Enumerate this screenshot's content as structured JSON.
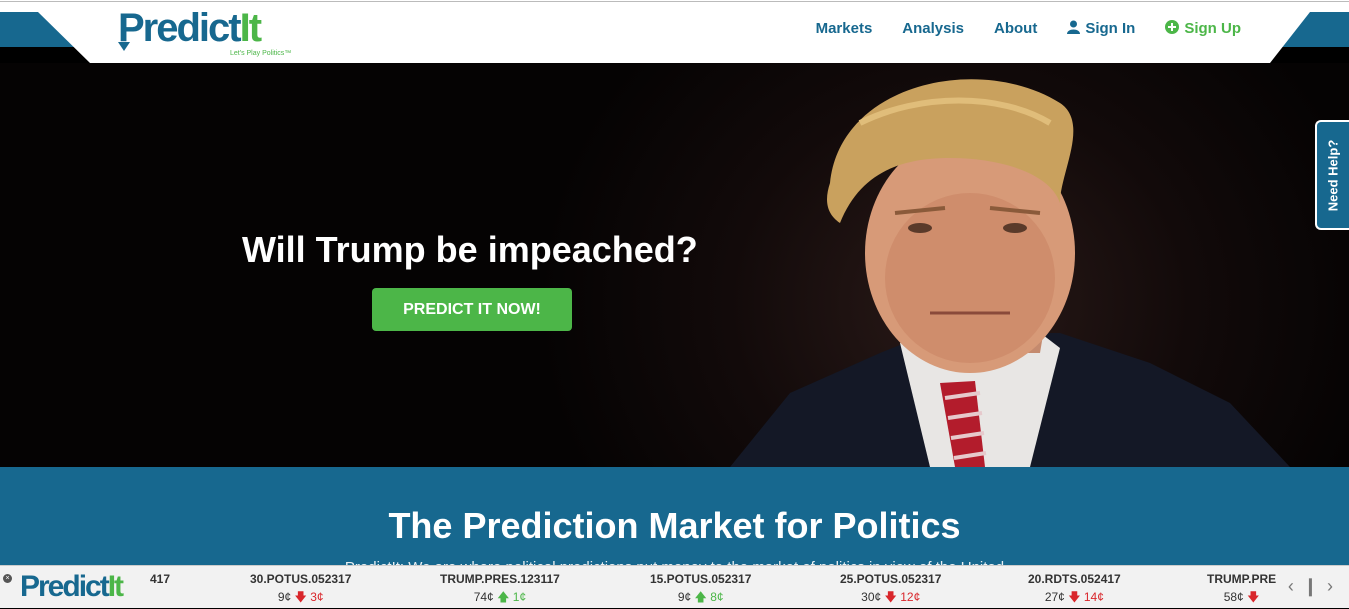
{
  "header": {
    "logo_left": "Predict",
    "logo_right": "It",
    "logo_tagline": "Let's Play Politics™",
    "nav": {
      "markets": "Markets",
      "analysis": "Analysis",
      "about": "About",
      "signin": "Sign In",
      "signup": "Sign Up"
    }
  },
  "hero": {
    "title": "Will Trump be impeached?",
    "button": "PREDICT IT NOW!"
  },
  "help_tab": "Need Help?",
  "section": {
    "title": "The Prediction Market for Politics",
    "subtitle": "PredictIt: We are where political predictions put money to the market of politics in view of the United"
  },
  "ticker": {
    "logo_left": "Predict",
    "logo_right": "It",
    "partial": "417",
    "items": [
      {
        "symbol": "30.POTUS.052317",
        "price": "9¢",
        "dir": "down",
        "change": "3¢"
      },
      {
        "symbol": "TRUMP.PRES.123117",
        "price": "74¢",
        "dir": "up",
        "change": "1¢"
      },
      {
        "symbol": "15.POTUS.052317",
        "price": "9¢",
        "dir": "up",
        "change": "8¢"
      },
      {
        "symbol": "25.POTUS.052317",
        "price": "30¢",
        "dir": "down",
        "change": "12¢"
      },
      {
        "symbol": "20.RDTS.052417",
        "price": "27¢",
        "dir": "down",
        "change": "14¢"
      },
      {
        "symbol": "TRUMP.PRE",
        "price": "58¢",
        "dir": "down",
        "change": ""
      }
    ],
    "controls": "‹ ❙ ›"
  },
  "colors": {
    "brand_blue": "#17688f",
    "brand_green": "#4cb648",
    "down_red": "#d9262b"
  }
}
